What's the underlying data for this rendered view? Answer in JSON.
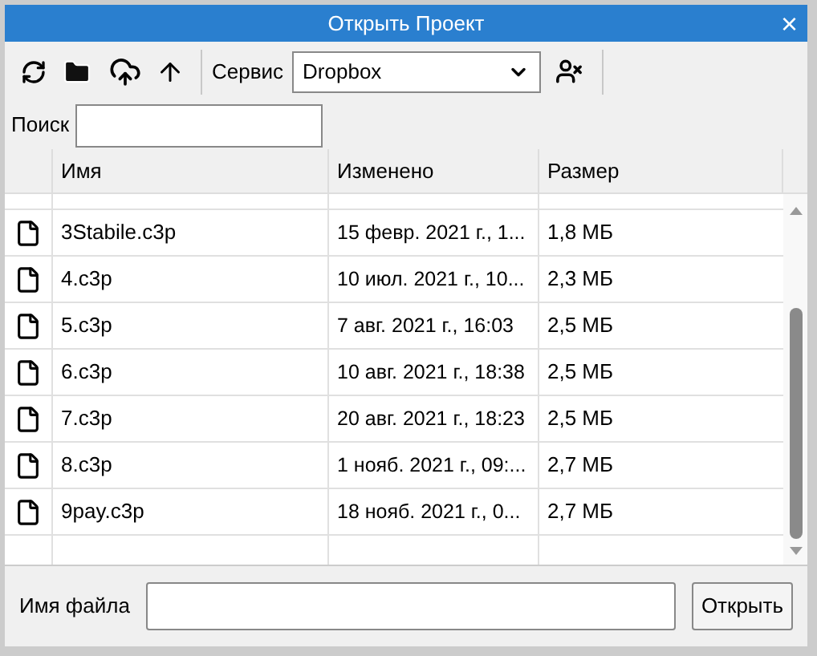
{
  "window": {
    "title": "Открыть Проект",
    "close": "×"
  },
  "toolbar": {
    "service_label": "Сервис",
    "service": "Dropbox"
  },
  "search": {
    "label": "Поиск"
  },
  "table": {
    "columns": [
      "Имя",
      "Изменено",
      "Размер"
    ],
    "rows": [
      {
        "name": "3Stabile.c3p",
        "modified": "15 февр. 2021 г., 1...",
        "size": "1,8 МБ"
      },
      {
        "name": "4.c3p",
        "modified": "10 июл. 2021 г., 10...",
        "size": "2,3 МБ"
      },
      {
        "name": "5.c3p",
        "modified": "7 авг. 2021 г., 16:03",
        "size": "2,5 МБ"
      },
      {
        "name": "6.c3p",
        "modified": "10 авг. 2021 г., 18:38",
        "size": "2,5 МБ"
      },
      {
        "name": "7.c3p",
        "modified": "20 авг. 2021 г., 18:23",
        "size": "2,5 МБ"
      },
      {
        "name": "8.c3p",
        "modified": "1 нояб. 2021 г., 09:...",
        "size": "2,7 МБ"
      },
      {
        "name": "9pay.c3p",
        "modified": "18 нояб. 2021 г., 0...",
        "size": "2,7 МБ"
      }
    ]
  },
  "footer": {
    "filename_label": "Имя файла",
    "open_button": "Открыть"
  }
}
